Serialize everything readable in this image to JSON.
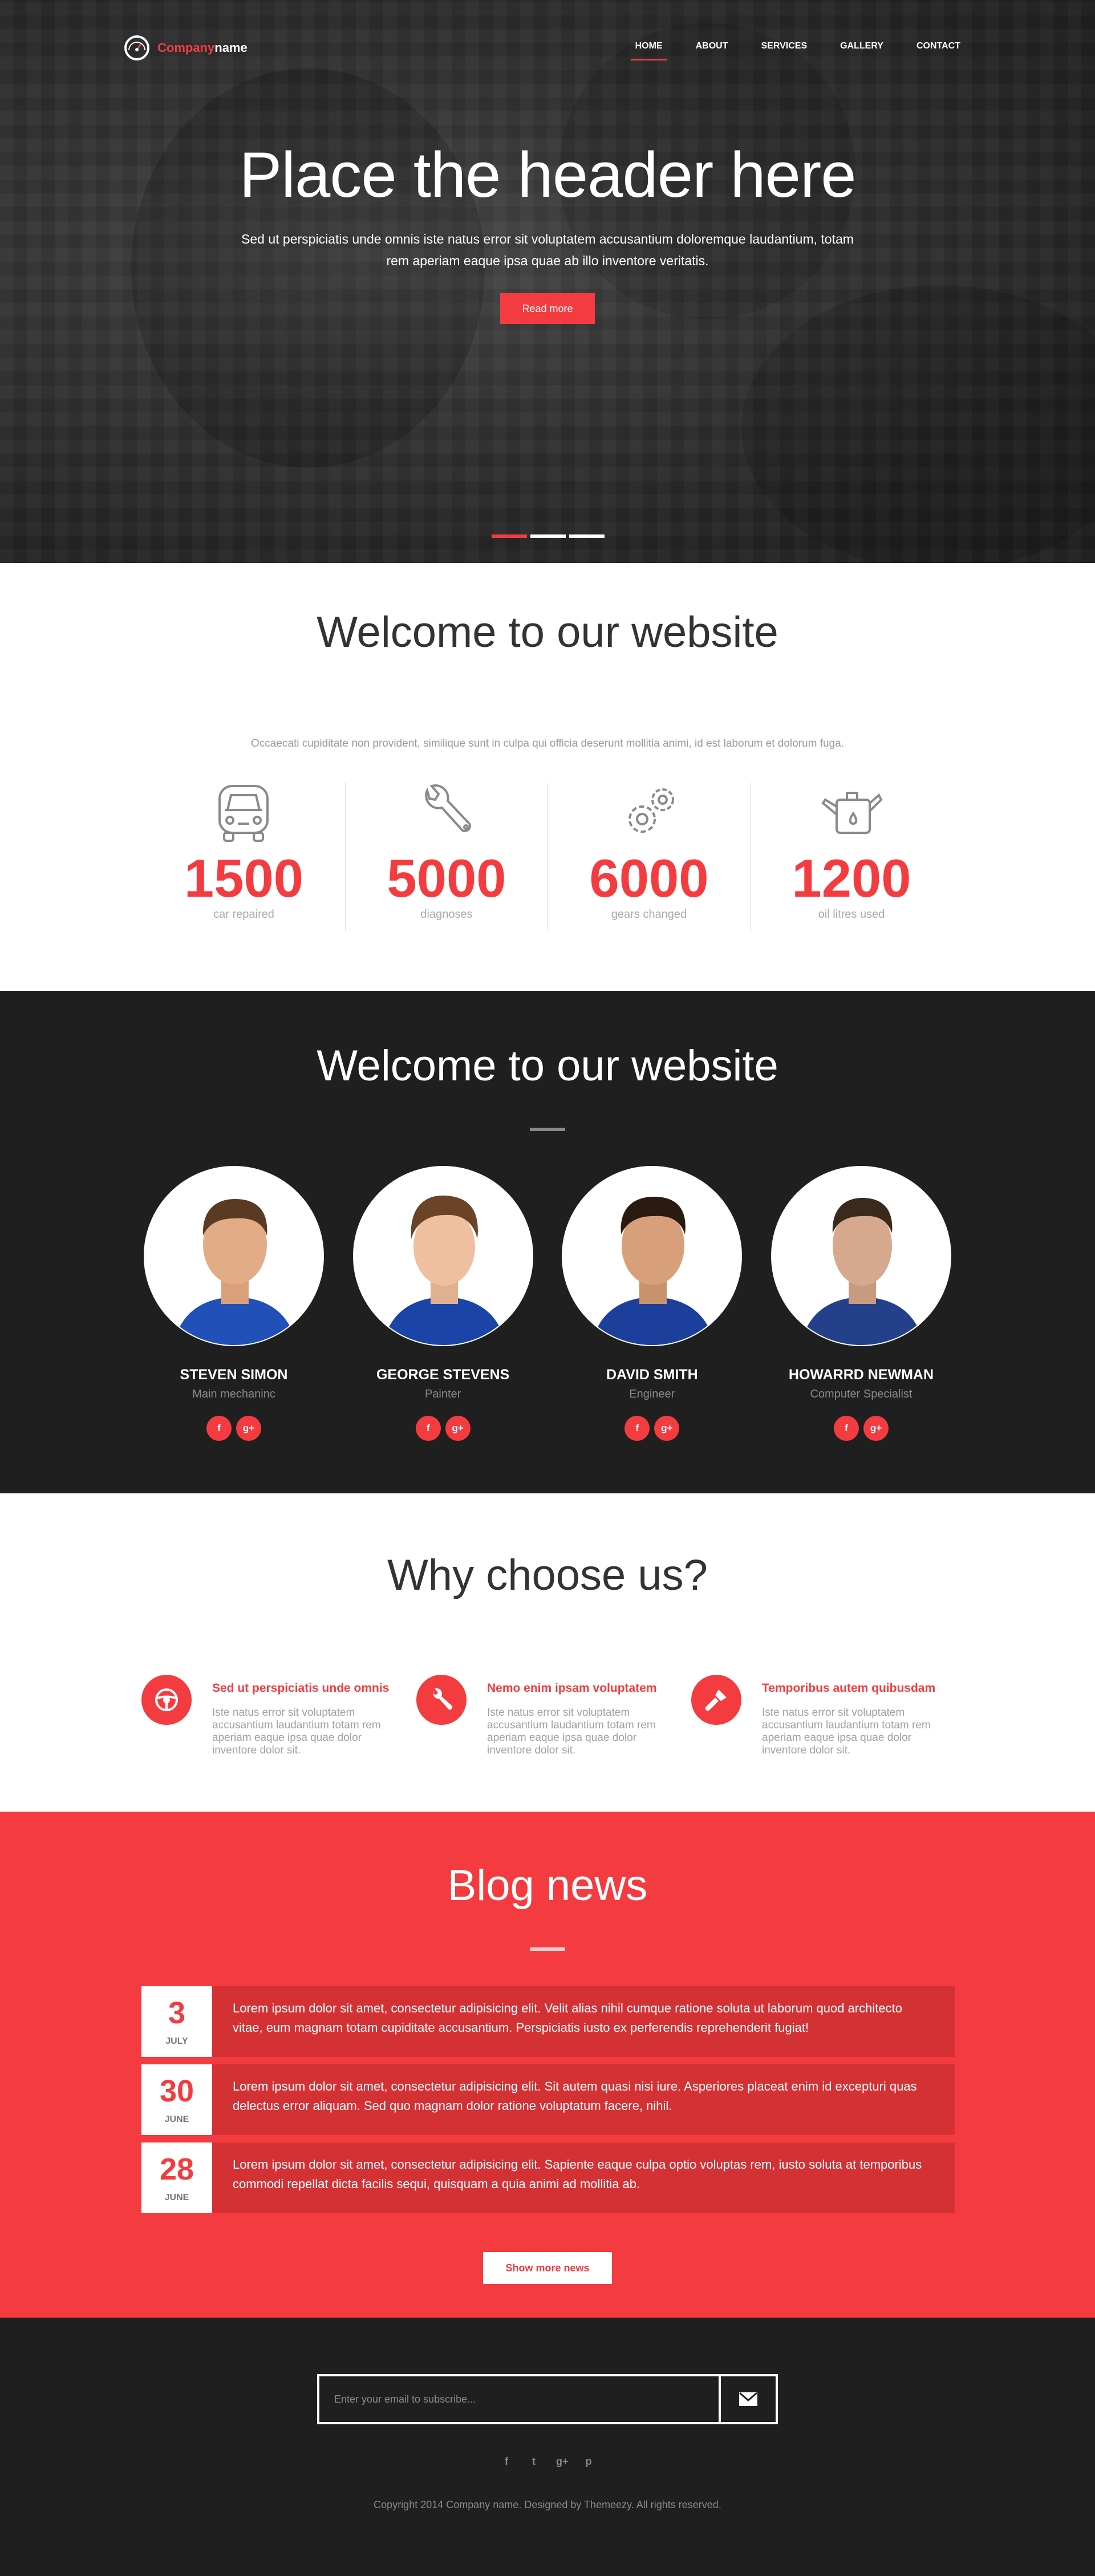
{
  "brand": {
    "name_a": "Company",
    "name_b": "name",
    "accent": "#f43c40"
  },
  "nav": [
    {
      "label": "HOME",
      "active": true
    },
    {
      "label": "ABOUT",
      "active": false
    },
    {
      "label": "SERVICES",
      "active": false
    },
    {
      "label": "GALLERY",
      "active": false
    },
    {
      "label": "CONTACT",
      "active": false
    }
  ],
  "hero": {
    "title": "Place the header here",
    "text": "Sed ut perspiciatis unde omnis iste natus error sit voluptatem accusantium doloremque laudantium, totam rem aperiam eaque ipsa quae ab illo inventore veritatis.",
    "button": "Read more",
    "slides": 3,
    "active_slide": 1
  },
  "stats": {
    "title": "Welcome to our website",
    "intro": "Occaecati cupiditate non provident, similique sunt in culpa qui officia deserunt mollitia animi, id est laborum et dolorum fuga.",
    "items": [
      {
        "icon": "car-icon",
        "value": "1500",
        "label": "car repaired"
      },
      {
        "icon": "wrench-icon",
        "value": "5000",
        "label": "diagnoses"
      },
      {
        "icon": "gears-icon",
        "value": "6000",
        "label": "gears changed"
      },
      {
        "icon": "oil-can-icon",
        "value": "1200",
        "label": "oil litres used"
      }
    ]
  },
  "team": {
    "title": "Welcome to our website",
    "members": [
      {
        "name": "STEVEN SIMON",
        "role": "Main mechaninc"
      },
      {
        "name": "GEORGE STEVENS",
        "role": "Painter"
      },
      {
        "name": "DAVID SMITH",
        "role": "Engineer"
      },
      {
        "name": "HOWARRD NEWMAN",
        "role": "Computer Specialist"
      }
    ],
    "social": [
      "f",
      "g+"
    ]
  },
  "why": {
    "title": "Why choose us?",
    "features": [
      {
        "icon": "steering-wheel-icon",
        "title": "Sed ut perspiciatis unde omnis",
        "text": "Iste natus error sit voluptatem accusantium laudantium totam rem aperiam eaque ipsa quae dolor inventore dolor sit."
      },
      {
        "icon": "wrench-icon",
        "title": "Nemo enim ipsam voluptatem",
        "text": "Iste natus error sit voluptatem accusantium laudantium totam rem aperiam eaque ipsa quae dolor inventore dolor sit."
      },
      {
        "icon": "paint-brush-icon",
        "title": "Temporibus autem quibusdam",
        "text": "Iste natus error sit voluptatem accusantium laudantium totam rem aperiam eaque ipsa quae dolor inventore dolor sit."
      }
    ]
  },
  "blog": {
    "title": "Blog news",
    "posts": [
      {
        "day": "3",
        "month": "JULY",
        "text": "Lorem ipsum dolor sit amet, consectetur adipisicing elit. Velit alias nihil cumque ratione soluta ut laborum quod architecto vitae, eum magnam totam cupiditate accusantium. Perspiciatis iusto ex perferendis reprehenderit fugiat!"
      },
      {
        "day": "30",
        "month": "JUNE",
        "text": "Lorem ipsum dolor sit amet, consectetur adipisicing elit. Sit autem quasi nisi iure. Asperiores placeat enim id excepturi quas delectus error aliquam. Sed quo magnam dolor ratione voluptatum facere, nihil."
      },
      {
        "day": "28",
        "month": "JUNE",
        "text": "Lorem ipsum dolor sit amet, consectetur adipisicing elit. Sapiente eaque culpa optio voluptas rem, iusto soluta at temporibus commodi repellat dicta facilis sequi, quisquam a quia animi ad mollitia ab."
      }
    ],
    "more_button": "Show more news"
  },
  "footer": {
    "subscribe_placeholder": "Enter your email to subscribe...",
    "social": [
      "f",
      "t",
      "g+",
      "p"
    ],
    "copyright": "Copyright 2014 Company name. Designed by Themeezy. All rights reserved."
  }
}
